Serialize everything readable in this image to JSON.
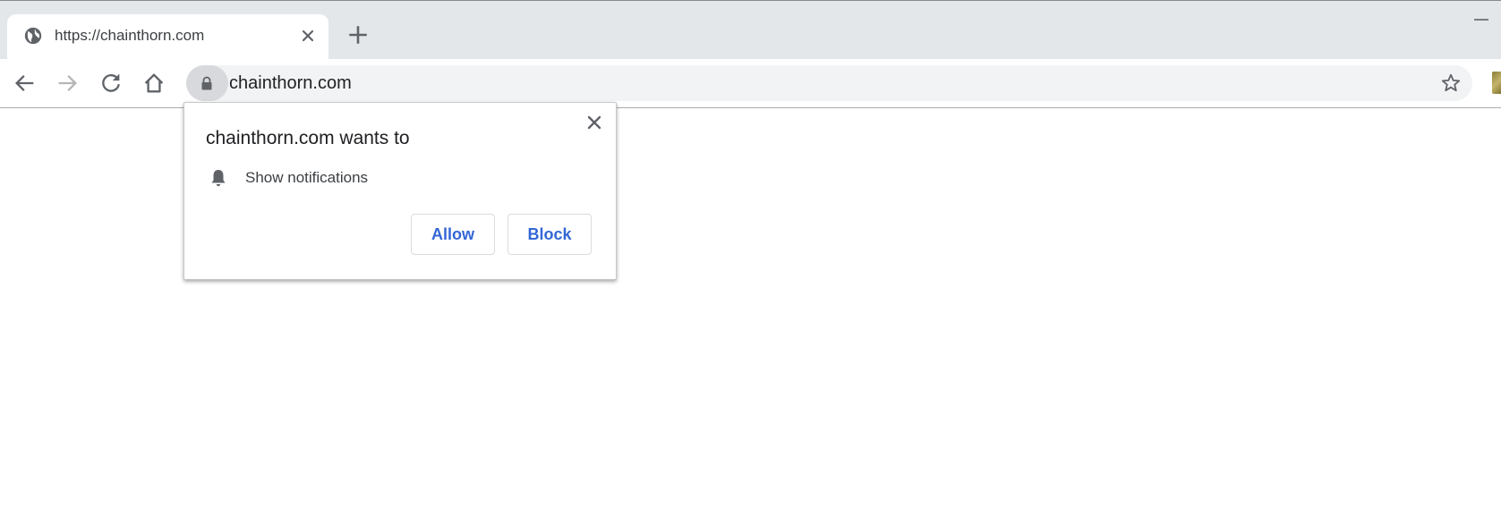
{
  "browser": {
    "tab": {
      "title": "https://chainthorn.com",
      "favicon": "globe-icon",
      "close_icon": "close-icon"
    },
    "new_tab_icon": "plus-icon",
    "window_controls": {
      "minimize_icon": "minimize-icon"
    },
    "toolbar": {
      "back_icon": "arrow-left-icon",
      "forward_icon": "arrow-right-icon",
      "reload_icon": "reload-icon",
      "home_icon": "home-icon",
      "site_info_icon": "lock-icon",
      "url": "chainthorn.com",
      "bookmark_icon": "star-icon",
      "extension_icon": "extension-icon"
    }
  },
  "permission_prompt": {
    "title": "chainthorn.com wants to",
    "permission": {
      "icon": "bell-icon",
      "label": "Show notifications"
    },
    "allow_label": "Allow",
    "block_label": "Block",
    "close_icon": "close-icon"
  },
  "colors": {
    "accent_blue": "#3367d6",
    "tabstrip_bg": "#e4e7ea",
    "omnibox_bg": "#f1f3f4",
    "icon_gray": "#5f6368"
  }
}
